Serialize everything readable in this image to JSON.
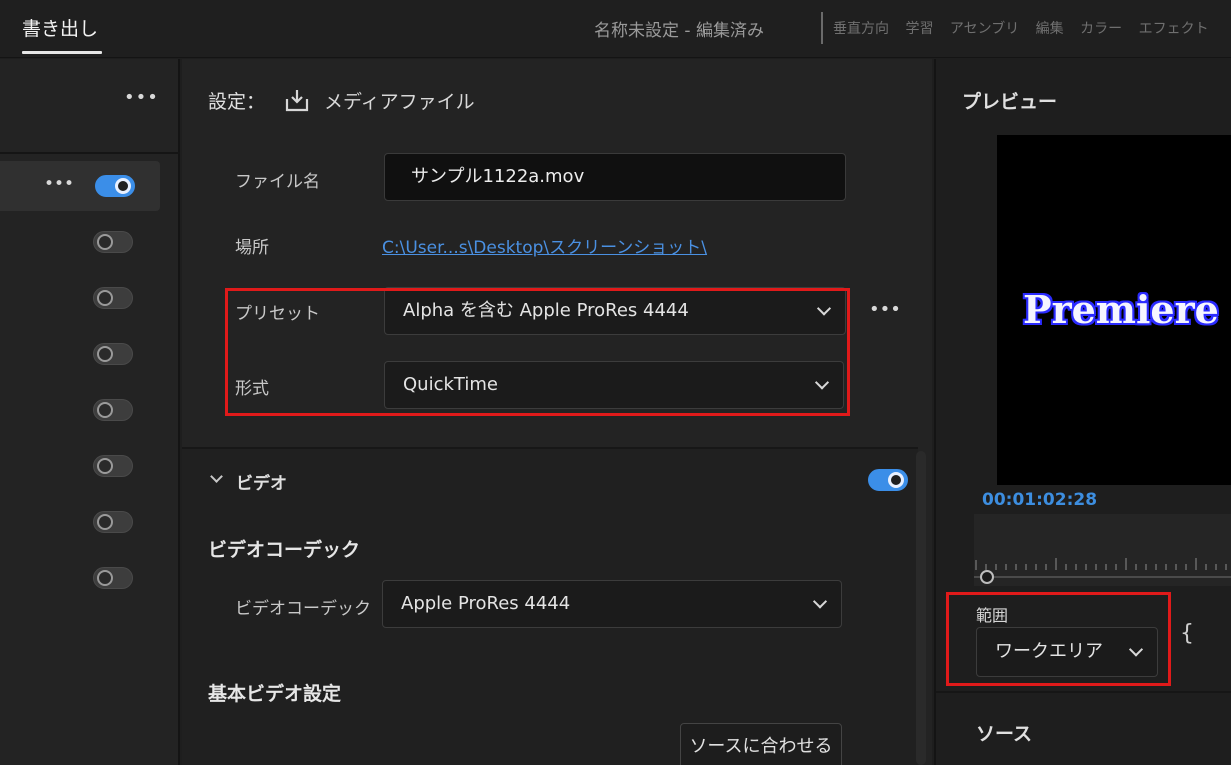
{
  "topbar": {
    "export_tab": "書き出し",
    "project_title": "名称未設定 - 編集済み",
    "workspace_tabs": [
      "垂直方向",
      "学習",
      "アセンブリ",
      "編集",
      "カラー",
      "エフェクト"
    ]
  },
  "left": {
    "more_label": "•••",
    "destinations": [
      {
        "enabled": true
      },
      {
        "enabled": false
      },
      {
        "enabled": false
      },
      {
        "enabled": false
      },
      {
        "enabled": false
      },
      {
        "enabled": false
      },
      {
        "enabled": false
      },
      {
        "enabled": false
      }
    ]
  },
  "settings": {
    "heading": "設定：",
    "media_file": "メディアファイル",
    "filename_label": "ファイル名",
    "filename_value": "サンプル1122a.mov",
    "location_label": "場所",
    "location_value": "C:\\User...s\\Desktop\\スクリーンショット\\",
    "preset_label": "プリセット",
    "preset_value": "Alpha を含む Apple ProRes 4444",
    "preset_more": "•••",
    "format_label": "形式",
    "format_value": "QuickTime"
  },
  "video": {
    "section_title": "ビデオ",
    "enabled": true,
    "codec_heading": "ビデオコーデック",
    "codec_label": "ビデオコーデック",
    "codec_value": "Apple ProRes 4444",
    "basic_heading": "基本ビデオ設定",
    "match_source_button": "ソースに合わせる"
  },
  "preview": {
    "title": "プレビュー",
    "frame_text": "Premiere Pr",
    "timecode": "00:01:02:28",
    "range_label": "範囲",
    "range_value": "ワークエリア",
    "brace": "{",
    "source_title": "ソース"
  },
  "colors": {
    "accent": "#3b8ee8",
    "highlight": "#e01a1a",
    "link": "#4a90e2"
  },
  "icons": {
    "download": "download-icon",
    "chevron": "chevron-down-icon",
    "more": "more-icon"
  }
}
